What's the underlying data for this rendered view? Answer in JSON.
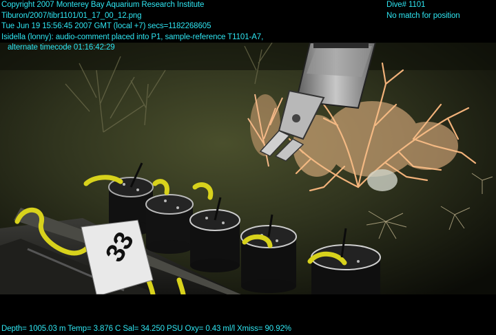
{
  "overlay": {
    "header_left": [
      "Copyright 2007 Monterey Bay Aquarium Research Institute",
      "Tiburon/2007/tibr1101/01_17_00_12.png",
      "Tue Jun 19 15:56:45 2007 GMT (local +7)  secs=1182268605",
      "Isidella (lonny): audio-comment placed into P1, sample-reference T1101-A7,",
      "alternate timecode 01:16:42:29"
    ],
    "header_right": [
      "Dive# 1101",
      "No match for position"
    ],
    "footer": "Depth= 1005.03 m  Temp= 3.876 C  Sal= 34.250 PSU  Oxy= 0.43 ml/l  Xmiss= 90.92%"
  },
  "marker_text": "33",
  "colors": {
    "overlay_text": "#2fe6f2",
    "seafloor": "#2b2f1c",
    "coral": "#f2b27a",
    "rope": "#d8d21c"
  }
}
